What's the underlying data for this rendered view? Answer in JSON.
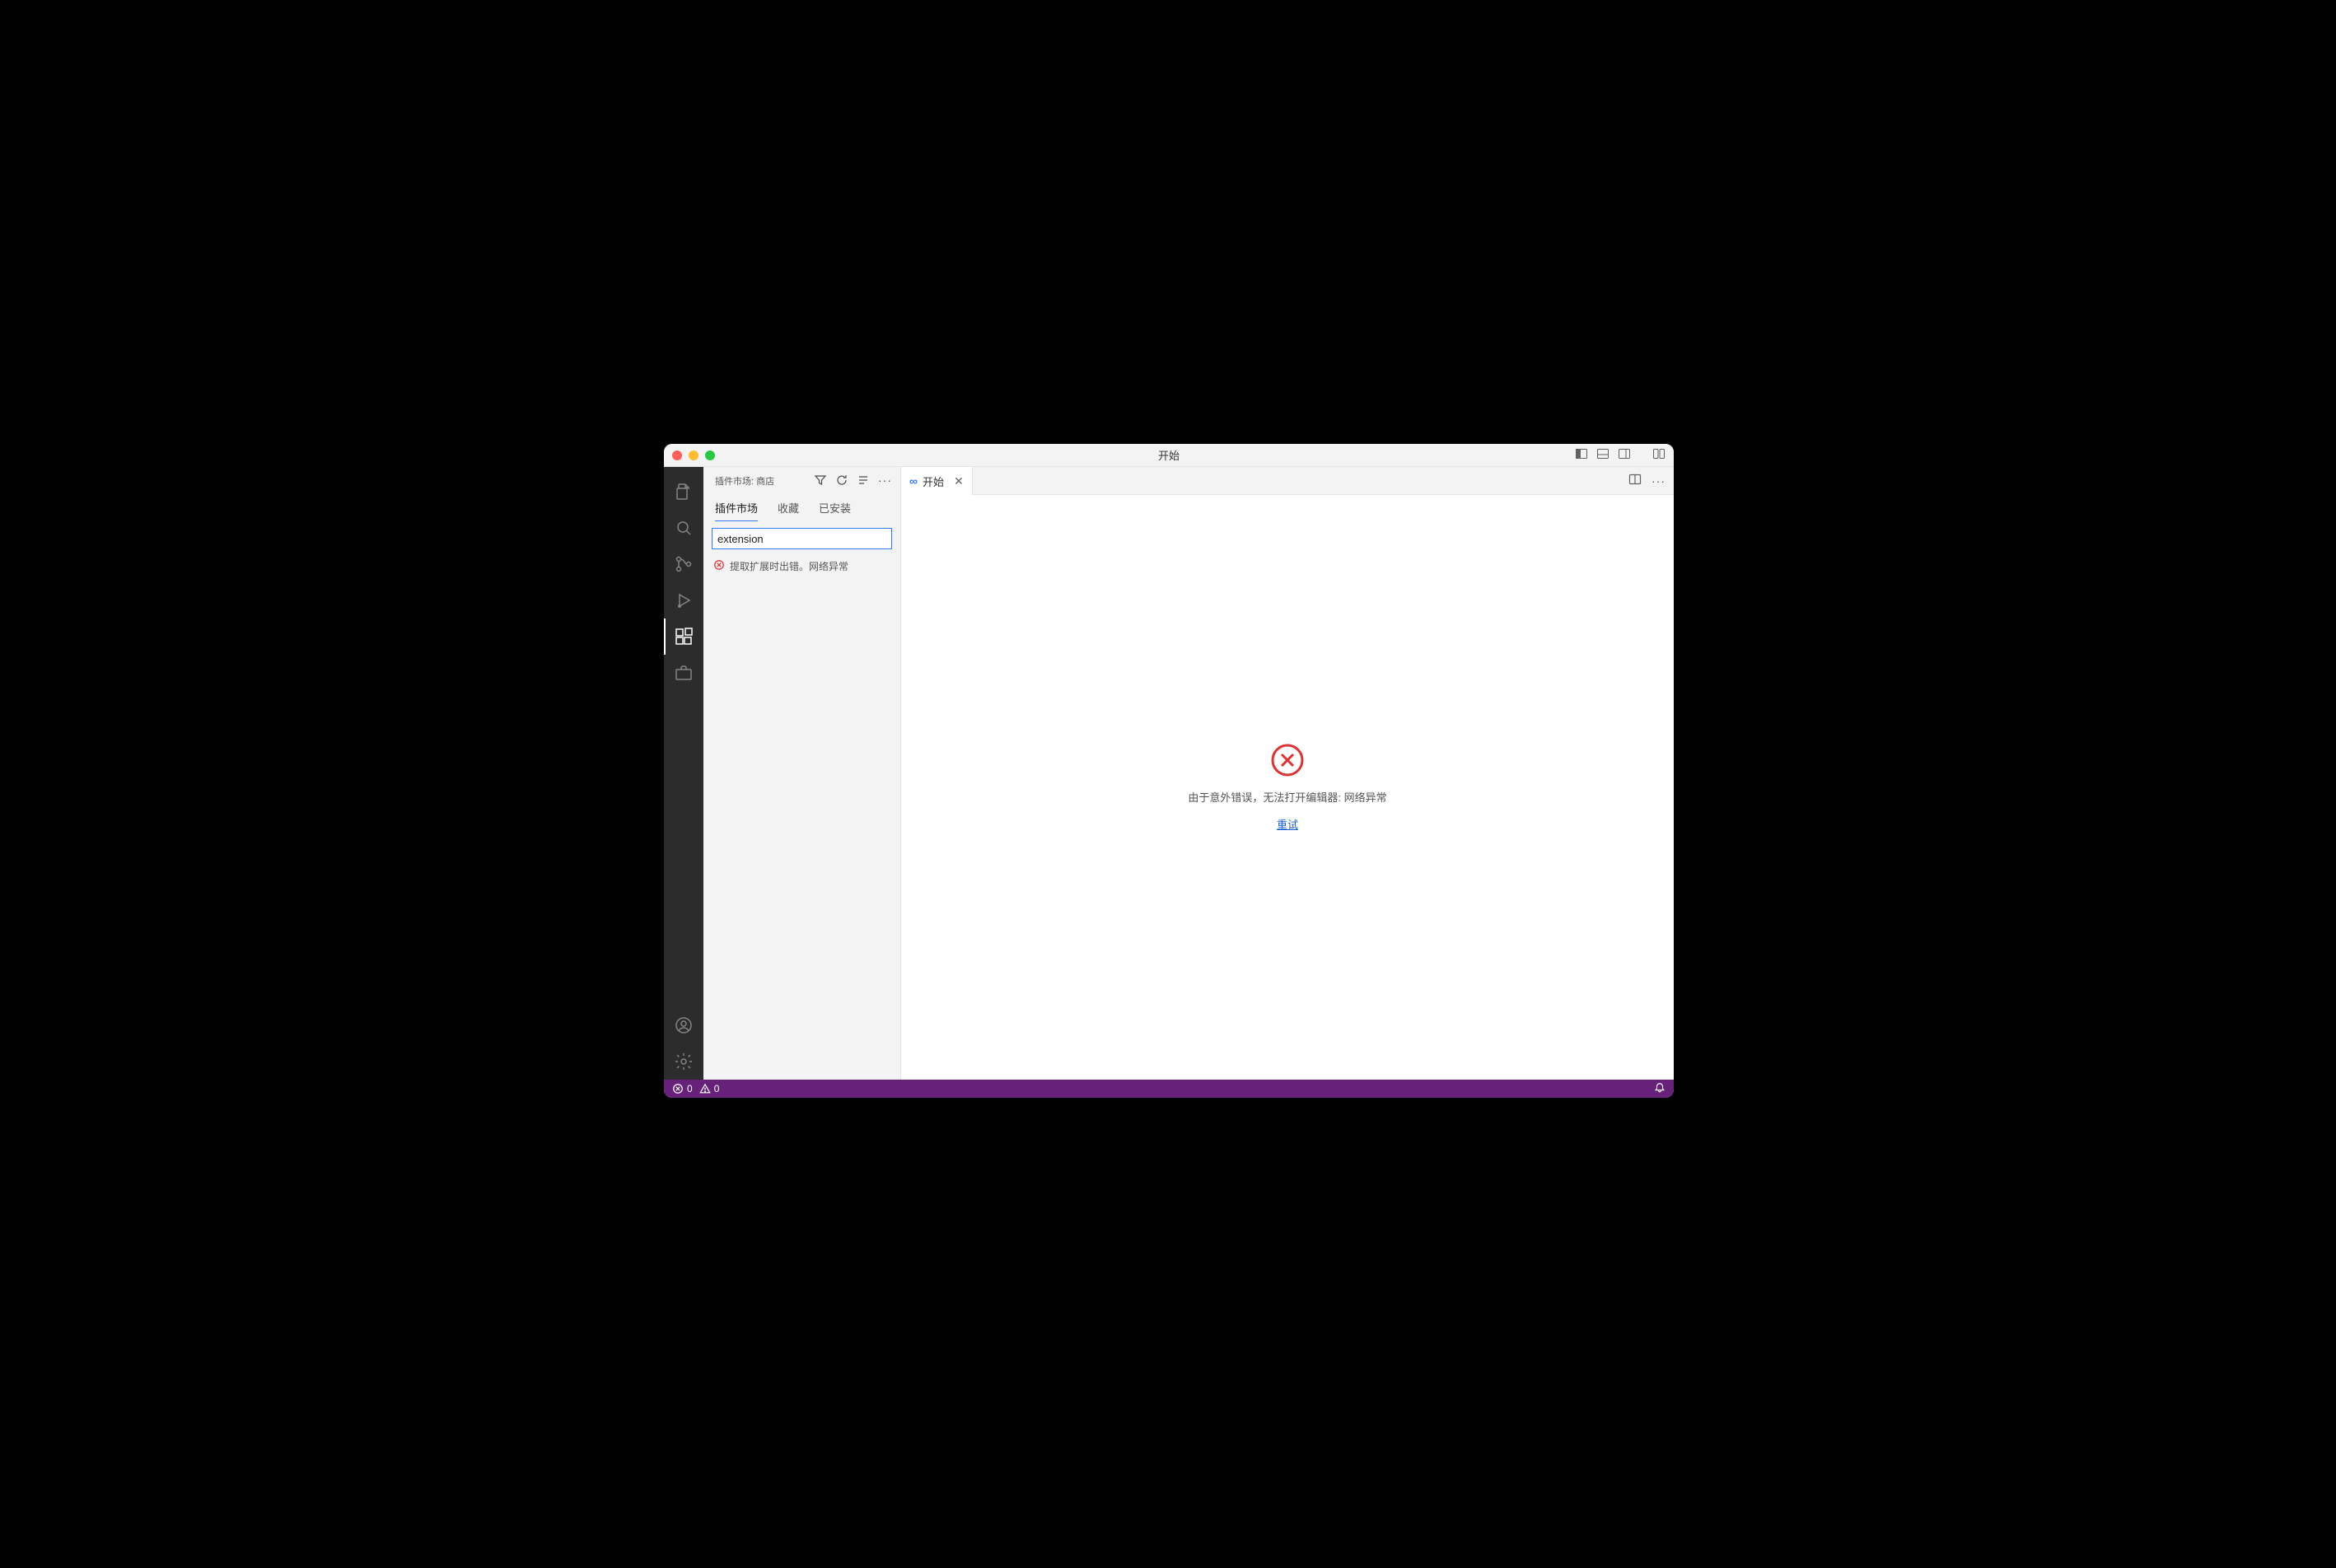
{
  "titlebar": {
    "title": "开始"
  },
  "sidebar": {
    "header_title": "插件市场: 商店",
    "tabs": [
      {
        "label": "插件市场",
        "active": true
      },
      {
        "label": "收藏",
        "active": false
      },
      {
        "label": "已安装",
        "active": false
      }
    ],
    "search_value": "extension",
    "error_message": "提取扩展时出错。网络异常"
  },
  "editor": {
    "tab_label": "开始",
    "error_text": "由于意外错误，无法打开编辑器: 网络异常",
    "retry_label": "重试"
  },
  "statusbar": {
    "errors": "0",
    "warnings": "0"
  },
  "activitybar": {
    "items": [
      {
        "name": "explorer-icon"
      },
      {
        "name": "search-icon"
      },
      {
        "name": "source-control-icon"
      },
      {
        "name": "run-debug-icon"
      },
      {
        "name": "extensions-icon"
      },
      {
        "name": "toolbox-icon"
      }
    ],
    "bottom_items": [
      {
        "name": "accounts-icon"
      },
      {
        "name": "settings-gear-icon"
      }
    ]
  }
}
